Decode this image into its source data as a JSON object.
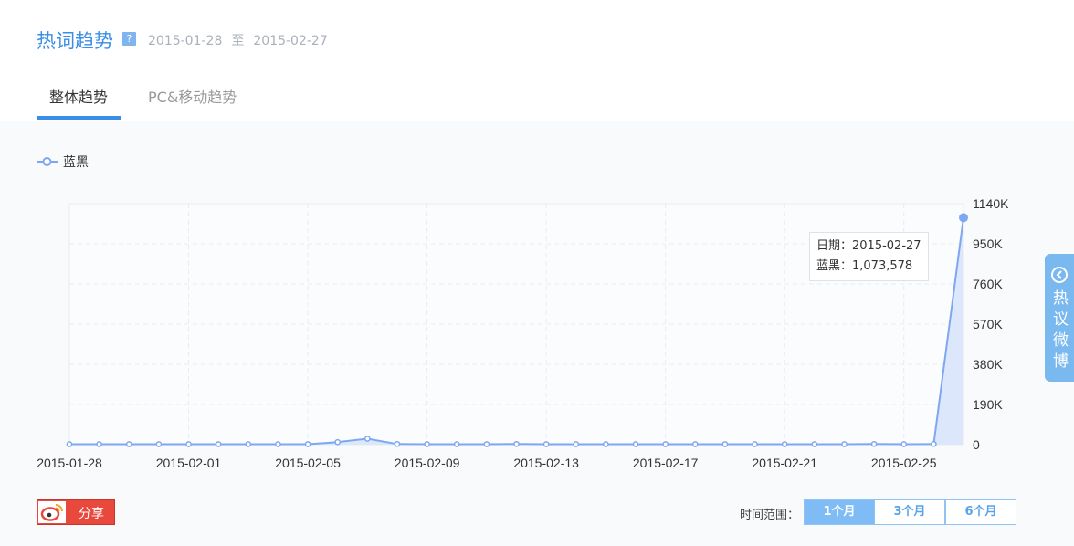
{
  "header": {
    "title": "热词趋势",
    "help_icon": "?",
    "date_start": "2015-01-28",
    "date_sep": "至",
    "date_end": "2015-02-27"
  },
  "tabs": [
    {
      "label": "整体趋势",
      "active": true
    },
    {
      "label": "PC&移动趋势",
      "active": false
    }
  ],
  "tooltip": {
    "line1": "日期：2015-02-27",
    "line2": "蓝黑：1,073,578"
  },
  "footer": {
    "share_label": "分享",
    "range_label": "时间范围：",
    "ranges": [
      "1个月",
      "3个月",
      "6个月"
    ],
    "active_range": "1个月"
  },
  "side_tab": {
    "icon": "arrow-circle-left-icon",
    "label": "热议微博"
  },
  "colors": {
    "accent": "#3a8ee6",
    "line": "#7ea7f2",
    "area": "#dde7fb",
    "share_red": "#e9493d"
  },
  "chart_data": {
    "type": "area",
    "legend_position": "top-left",
    "grid": true,
    "y_axis_position": "right",
    "series": [
      {
        "name": "蓝黑",
        "x": [
          "2015-01-28",
          "2015-01-29",
          "2015-01-30",
          "2015-01-31",
          "2015-02-01",
          "2015-02-02",
          "2015-02-03",
          "2015-02-04",
          "2015-02-05",
          "2015-02-06",
          "2015-02-07",
          "2015-02-08",
          "2015-02-09",
          "2015-02-10",
          "2015-02-11",
          "2015-02-12",
          "2015-02-13",
          "2015-02-14",
          "2015-02-15",
          "2015-02-16",
          "2015-02-17",
          "2015-02-18",
          "2015-02-19",
          "2015-02-20",
          "2015-02-21",
          "2015-02-22",
          "2015-02-23",
          "2015-02-24",
          "2015-02-25",
          "2015-02-26",
          "2015-02-27"
        ],
        "values": [
          2000,
          2000,
          2000,
          2000,
          2000,
          2000,
          2000,
          2000,
          2000,
          12000,
          28000,
          3000,
          2000,
          2000,
          2000,
          3000,
          2000,
          2000,
          2000,
          2000,
          2000,
          2000,
          2000,
          2000,
          2000,
          2000,
          2000,
          3000,
          2000,
          3000,
          1073578
        ]
      }
    ],
    "x_tick_labels": [
      "2015-01-28",
      "2015-02-01",
      "2015-02-05",
      "2015-02-09",
      "2015-02-13",
      "2015-02-17",
      "2015-02-21",
      "2015-02-25"
    ],
    "y_ticks": [
      0,
      190000,
      380000,
      570000,
      760000,
      950000,
      1140000
    ],
    "y_tick_labels": [
      "0",
      "190K",
      "380K",
      "570K",
      "760K",
      "950K",
      "1140K"
    ],
    "ylim": [
      0,
      1140000
    ]
  }
}
